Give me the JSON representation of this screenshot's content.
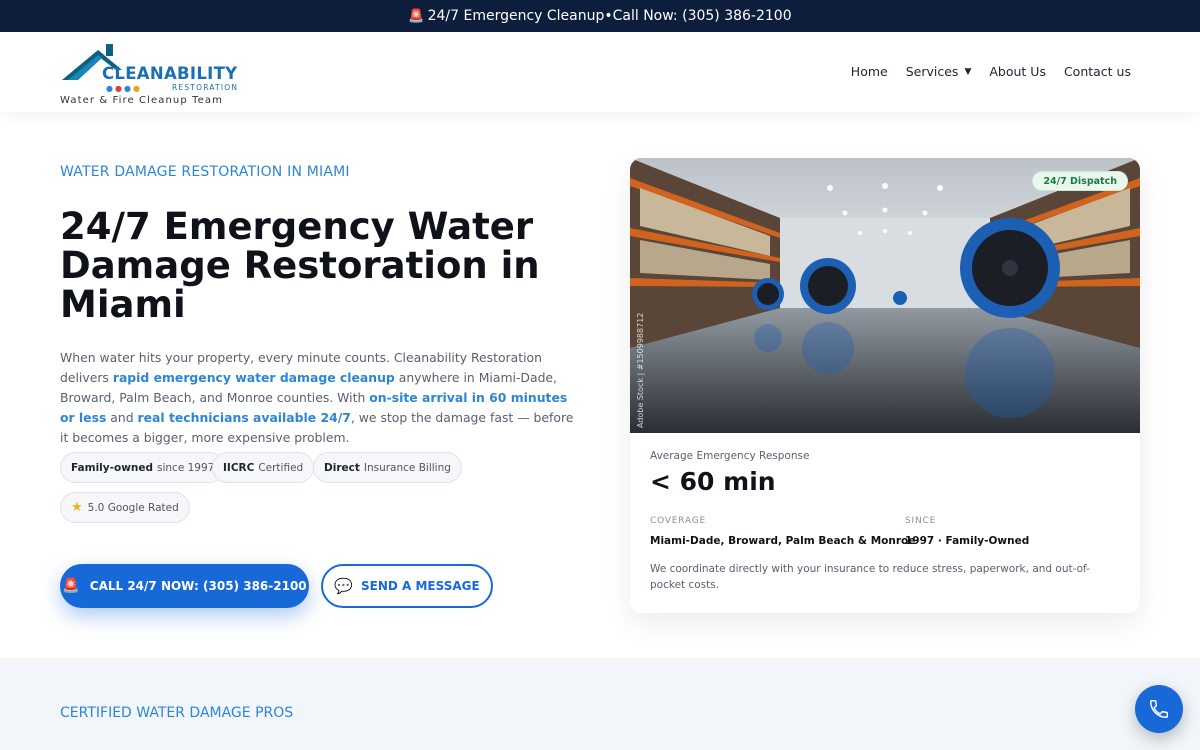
{
  "topbar": {
    "siren_icon": "siren-icon",
    "text": "24/7 Emergency Cleanup•Call Now: (305) 386-2100"
  },
  "logo": {
    "name": "CLEANABILITY",
    "sub": "RESTORATION",
    "tagline": "Water & Fire Cleanup Team"
  },
  "nav": {
    "items": [
      {
        "label": "Home"
      },
      {
        "label": "Services"
      },
      {
        "label": "About Us"
      },
      {
        "label": "Contact us"
      }
    ]
  },
  "hero": {
    "eyebrow": "WATER DAMAGE RESTORATION IN MIAMI",
    "title": "24/7 Emergency Water Damage Restoration in Miami",
    "lead": {
      "p1": "When water hits your property, every minute counts. Cleanability Restoration delivers ",
      "b1": "rapid emergency water damage cleanup",
      "p2": " anywhere in Miami-Dade, Broward, Palm Beach, and Monroe counties. With ",
      "b2": "on-site arrival in 60 minutes or less",
      "p3": " and ",
      "b3": "real technicians available 24/7",
      "p4": ", we stop the damage fast — before it becomes a bigger, more expensive problem."
    },
    "pills": [
      {
        "strong": "Family-owned",
        "text": "since 1997"
      },
      {
        "strong": "IICRC",
        "text": "Certified"
      },
      {
        "strong": "Direct",
        "text": "Insurance Billing"
      },
      {
        "strong": "",
        "text": "5.0 Google Rated"
      }
    ],
    "call_button": "CALL 24/7 NOW: (305) 386-2100",
    "message_button": "SEND A MESSAGE"
  },
  "card": {
    "badge": "24/7 Dispatch",
    "stock_credit": "Adobe Stock | #1509988712",
    "stat_label": "Average Emergency Response",
    "stat_value": "< 60 min",
    "coverage_label": "COVERAGE",
    "coverage_value": "Miami-Dade, Broward, Palm Beach & Monroe",
    "since_label": "SINCE",
    "since_value": "1997 · Family-Owned",
    "note": "We coordinate directly with your insurance to reduce stress, paperwork, and out-of-pocket costs."
  },
  "section2": {
    "eyebrow": "CERTIFIED WATER DAMAGE PROS"
  },
  "colors": {
    "accent": "#1769d8",
    "eyebrow": "#2d86d4",
    "topbar": "#0d1e3c",
    "badge_green": "#1b7a3e"
  }
}
